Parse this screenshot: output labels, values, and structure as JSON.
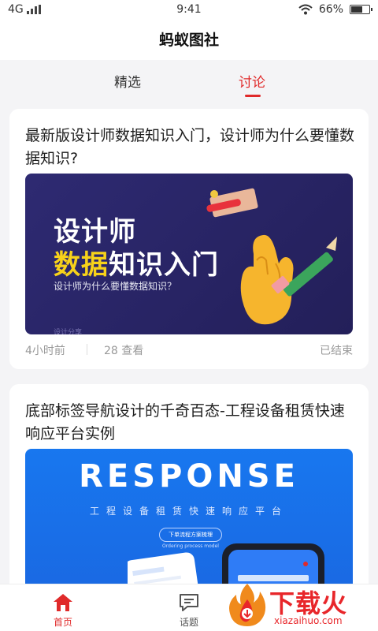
{
  "status_bar": {
    "network": "4G",
    "time": "9:41",
    "battery": "66%",
    "battery_level": 0.66
  },
  "header": {
    "title": "蚂蚁图社"
  },
  "tabs": [
    {
      "label": "精选",
      "active": false
    },
    {
      "label": "讨论",
      "active": true
    }
  ],
  "posts": [
    {
      "title": "最新版设计师数据知识入门，设计师为什么要懂数据知识?",
      "banner": {
        "line1": "设计师",
        "line2_highlight": "数据",
        "line2_rest": "知识入门",
        "subtitle": "设计师为什么要懂数据知识？",
        "footer": "设计分享"
      },
      "time": "4小时前",
      "views": "28 查看",
      "status": "已结束"
    },
    {
      "title": "底部标签导航设计的千奇百态-工程设备租赁快速响应平台实例",
      "banner": {
        "headline": "RESPONSE",
        "subtitle": "工程设备租赁快速响应平台",
        "button": "下单流程方案梳理",
        "button_sub": "Ordering process model"
      }
    }
  ],
  "bottom_nav": [
    {
      "label": "首页",
      "icon": "home-icon",
      "active": true
    },
    {
      "label": "话题",
      "icon": "chat-icon",
      "active": false
    }
  ],
  "watermark": {
    "text": "下载火",
    "url": "xiazaihuo.com"
  },
  "colors": {
    "accent": "#e02a2a",
    "banner1_bg": "#2e2a72",
    "banner2_bg": "#1877ef",
    "highlight": "#f7d21a"
  }
}
